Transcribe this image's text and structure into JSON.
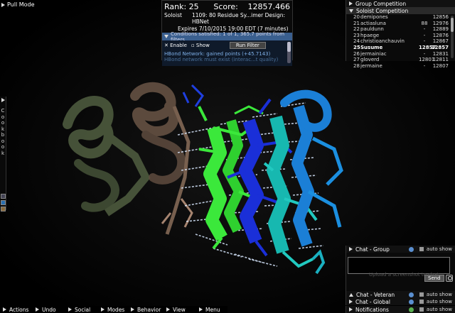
{
  "pull_mode": "Pull Mode",
  "score_panel": {
    "rank_label": "Rank: 25",
    "score_label": "Score:",
    "score_value": "12857.466",
    "mode": "Soloist",
    "puzzle": "1109: 80 Residue Sy...imer Design: HBNet",
    "expires": "Expires 7/10/2015 19:00 EDT (7 minutes)",
    "conditions": "Conditions satisfied: 1 of 1, 365.7 points from filters",
    "enable_label": "Enable",
    "show_label": "Show",
    "run_filter": "Run Filter",
    "hbond": "HBond Network: gained points (+45.7143)",
    "hbond_sub": "HBond network must exist (interac...t quality)"
  },
  "right_panel": {
    "group_competition": "Group Competition",
    "soloist_competition": "Soloist Competition",
    "rows": [
      {
        "rank": "20",
        "name": "demipones",
        "group": "",
        "score": "12856"
      },
      {
        "rank": "21",
        "name": "actiasluna",
        "group": "88",
        "score": "12976"
      },
      {
        "rank": "22",
        "name": "pauldunn",
        "group": "-",
        "score": "12889"
      },
      {
        "rank": "23",
        "name": "hpaege",
        "group": "-",
        "score": "12876"
      },
      {
        "rank": "24",
        "name": "christioanchauvin",
        "group": "-",
        "score": "12867"
      },
      {
        "rank": "25",
        "name": "Susume",
        "group": "12857",
        "score": "12857"
      },
      {
        "rank": "26",
        "name": "jermainiac",
        "group": "-",
        "score": "12831"
      },
      {
        "rank": "27",
        "name": "gloverd",
        "group": "12801",
        "score": "12811"
      },
      {
        "rank": "28",
        "name": "jermaine",
        "group": "-",
        "score": "12807"
      }
    ]
  },
  "cookbook": {
    "letters": [
      "C",
      "o",
      "o",
      "k",
      "b",
      "o",
      "o",
      "k"
    ]
  },
  "chat": {
    "group": "Chat - Group",
    "upload_hint": "Upload a screenshot to chat",
    "send": "Send",
    "veteran": "Chat - Veteran",
    "global": "Chat - Global",
    "notifications": "Notifications",
    "auto_show": "auto show"
  },
  "menu": [
    "Actions",
    "Undo",
    "Social",
    "Modes",
    "Behavior",
    "View",
    "Menu"
  ],
  "colors": {
    "chain_olive": "#5a6a48",
    "chain_brown": "#6a5546",
    "chain_green": "#3be83b",
    "chain_blue": "#1a2fd8",
    "chain_teal": "#17b8b0",
    "chain_sky": "#1b7fd6",
    "hbond": "#d8e8ff"
  }
}
